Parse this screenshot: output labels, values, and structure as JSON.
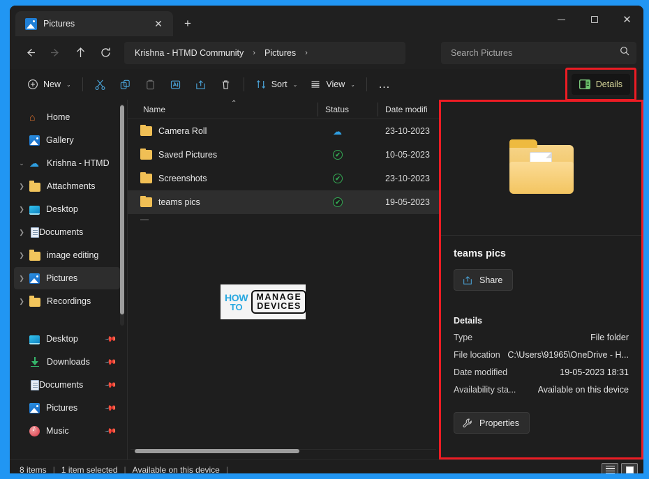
{
  "window": {
    "tab": {
      "title": "Pictures",
      "icon": "pictures-icon",
      "close": "✕"
    },
    "newtab_label": "+",
    "controls": {
      "minimize": "minimize",
      "maximize": "maximize",
      "close": "✕"
    }
  },
  "address": {
    "back": "back-arrow",
    "forward": "forward-arrow",
    "up": "up-arrow",
    "refresh": "refresh",
    "breadcrumbs": [
      {
        "label": "Krishna - HTMD Community"
      },
      {
        "label": "Pictures"
      }
    ],
    "separator": "›",
    "search": {
      "placeholder": "Search Pictures",
      "value": "",
      "icon": "search-icon"
    }
  },
  "toolbar": {
    "new_label": "New",
    "cut_label": "Cut",
    "copy_label": "Copy",
    "paste_label": "Paste",
    "rename_label": "Rename",
    "share_label": "Share",
    "delete_label": "Delete",
    "sort_label": "Sort",
    "view_label": "View",
    "more_label": "…",
    "details_label": "Details",
    "chevron": "⌄",
    "highlight_color": "#ec1c24"
  },
  "sidebar": {
    "items": [
      {
        "label": "Home",
        "icon": "home-icon",
        "expandable": false,
        "indent": 0,
        "selected": false,
        "pinned": false
      },
      {
        "label": "Gallery",
        "icon": "gallery-icon",
        "expandable": false,
        "indent": 0,
        "selected": false,
        "pinned": false
      },
      {
        "label": "Krishna - HTMD",
        "icon": "onedrive-icon",
        "expandable": true,
        "expanded": true,
        "indent": 0,
        "selected": false,
        "pinned": false
      },
      {
        "label": "Attachments",
        "icon": "folder-icon",
        "expandable": true,
        "indent": 1,
        "selected": false,
        "pinned": false
      },
      {
        "label": "Desktop",
        "icon": "desktop-icon",
        "expandable": true,
        "indent": 1,
        "selected": false,
        "pinned": false
      },
      {
        "label": "Documents",
        "icon": "document-icon",
        "expandable": true,
        "indent": 1,
        "selected": false,
        "pinned": false
      },
      {
        "label": "image editing",
        "icon": "folder-icon",
        "expandable": true,
        "indent": 1,
        "selected": false,
        "pinned": false
      },
      {
        "label": "Pictures",
        "icon": "gallery-icon",
        "expandable": true,
        "indent": 1,
        "selected": true,
        "pinned": false
      },
      {
        "label": "Recordings",
        "icon": "folder-icon",
        "expandable": true,
        "indent": 1,
        "selected": false,
        "pinned": false
      }
    ],
    "quick_items": [
      {
        "label": "Desktop",
        "icon": "desktop-icon",
        "pinned": true
      },
      {
        "label": "Downloads",
        "icon": "downloads-icon",
        "pinned": true
      },
      {
        "label": "Documents",
        "icon": "document-icon",
        "pinned": true
      },
      {
        "label": "Pictures",
        "icon": "gallery-icon",
        "pinned": true
      },
      {
        "label": "Music",
        "icon": "music-icon",
        "pinned": true
      }
    ],
    "pin_glyph": "📌"
  },
  "filelist": {
    "columns": [
      "Name",
      "Status",
      "Date modifi"
    ],
    "sort_indicator": "⌃",
    "rows": [
      {
        "name": "Camera Roll",
        "status": "cloud-only-icon",
        "date": "23-10-2023",
        "selected": false
      },
      {
        "name": "Saved Pictures",
        "status": "available-check-icon",
        "date": "10-05-2023",
        "selected": false
      },
      {
        "name": "Screenshots",
        "status": "available-check-icon",
        "date": "23-10-2023",
        "selected": false
      },
      {
        "name": "teams pics",
        "status": "available-check-icon",
        "date": "19-05-2023",
        "selected": true
      }
    ],
    "partial_row_glyph": "—",
    "watermark": {
      "how": "HOW",
      "to": "TO",
      "manage": "MANAGE",
      "devices": "DEVICES"
    }
  },
  "details_pane": {
    "preview_icon": "folder-with-picture-icon",
    "title": "teams pics",
    "share_label": "Share",
    "section_label": "Details",
    "fields": [
      {
        "key": "Type",
        "value": "File folder"
      },
      {
        "key": "File location",
        "value": "C:\\Users\\91965\\OneDrive - H..."
      },
      {
        "key": "Date modified",
        "value": "19-05-2023 18:31"
      },
      {
        "key": "Availability sta...",
        "value": "Available on this device"
      }
    ],
    "properties_label": "Properties",
    "highlight_color": "#ec1c24"
  },
  "statusbar": {
    "item_count": "8 items",
    "selection": "1 item selected",
    "availability": "Available on this device",
    "separator": "|",
    "view_list": "list-view",
    "view_icons": "large-icons-view"
  }
}
